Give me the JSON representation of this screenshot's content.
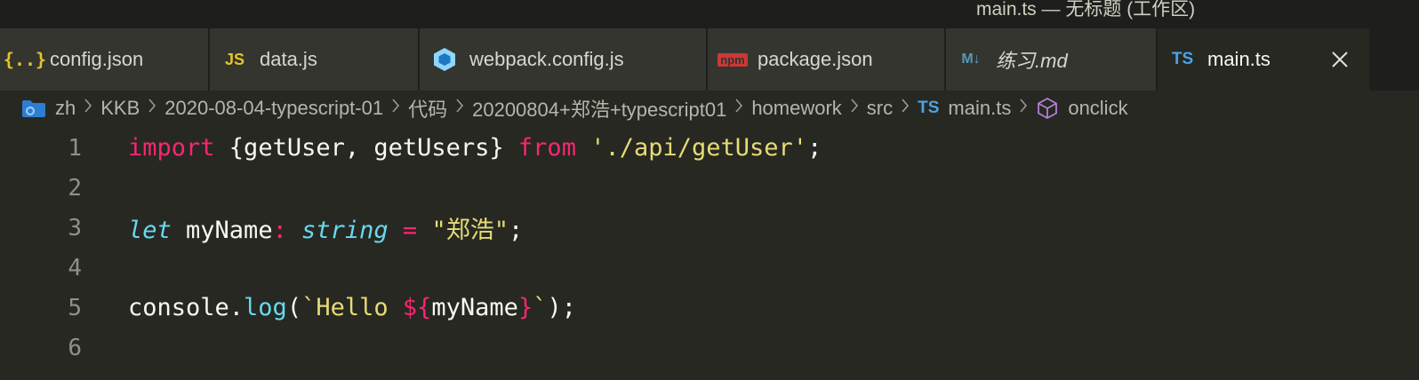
{
  "window": {
    "title": "main.ts — 无标题 (工作区)"
  },
  "tabs": [
    {
      "label": "config.json",
      "icon": "json-braces-icon",
      "width": 236
    },
    {
      "label": "data.js",
      "icon": "js-icon",
      "width": 236
    },
    {
      "label": "webpack.config.js",
      "icon": "webpack-icon",
      "width": 324
    },
    {
      "label": "package.json",
      "icon": "npm-icon",
      "width": 268
    },
    {
      "label": "练习.md",
      "icon": "markdown-icon",
      "width": 238
    },
    {
      "label": "main.ts",
      "icon": "ts-icon",
      "width": 238,
      "active": true
    }
  ],
  "breadcrumb": {
    "items": [
      "zh",
      "KKB",
      "2020-08-04-typescript-01",
      "代码",
      "20200804+郑浩+typescript01",
      "homework",
      "src",
      "main.ts",
      "onclick"
    ],
    "ts_badge": "TS"
  },
  "icons": {
    "js_text": "JS",
    "ts_text": "TS",
    "npm_text": "npm",
    "md_text": "M↓",
    "json_text": "{..}"
  },
  "editor": {
    "lines": [
      {
        "n": "1",
        "tokens": [
          [
            "kw",
            "import"
          ],
          [
            "punc",
            " {getUser, getUsers} "
          ],
          [
            "kw",
            "from"
          ],
          [
            "punc",
            " "
          ],
          [
            "str",
            "'./api/getUser'"
          ],
          [
            "punc",
            ";"
          ]
        ]
      },
      {
        "n": "2",
        "tokens": []
      },
      {
        "n": "3",
        "tokens": [
          [
            "type",
            "let"
          ],
          [
            "punc",
            " myName"
          ],
          [
            "kw",
            ":"
          ],
          [
            "punc",
            " "
          ],
          [
            "type",
            "string"
          ],
          [
            "punc",
            " "
          ],
          [
            "kw",
            "="
          ],
          [
            "punc",
            " "
          ],
          [
            "str",
            "\"郑浩\""
          ],
          [
            "punc",
            ";"
          ]
        ]
      },
      {
        "n": "4",
        "tokens": []
      },
      {
        "n": "5",
        "tokens": [
          [
            "punc",
            "console."
          ],
          [
            "fn",
            "log"
          ],
          [
            "punc",
            "("
          ],
          [
            "str",
            "`Hello "
          ],
          [
            "kw",
            "${"
          ],
          [
            "punc",
            "myName"
          ],
          [
            "kw",
            "}"
          ],
          [
            "str",
            "`"
          ],
          [
            "punc",
            ");"
          ]
        ]
      },
      {
        "n": "6",
        "tokens": []
      }
    ]
  }
}
